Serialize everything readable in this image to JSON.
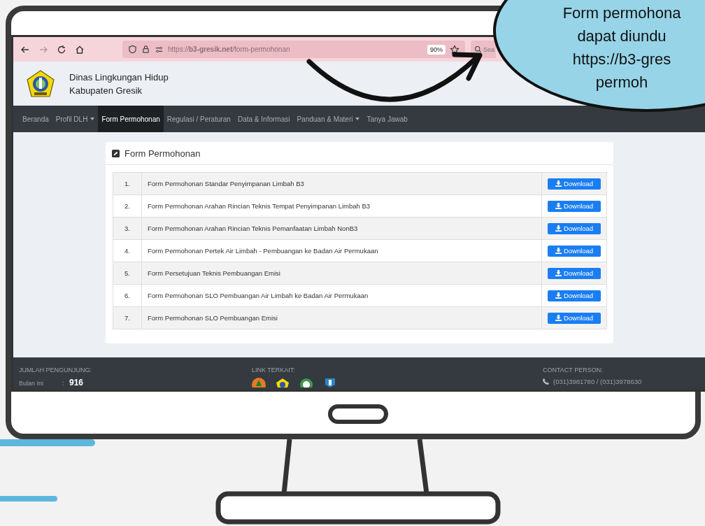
{
  "callout": {
    "lines": [
      "Form permohona",
      "dapat diundu",
      "https://b3-gres",
      "permoh"
    ]
  },
  "browser": {
    "forward_disabled": true,
    "url": "https://**b3-gresik.net**/form-permohonan",
    "zoom": "90%",
    "search": {
      "placeholder": "Sea"
    }
  },
  "site": {
    "name_lines": [
      "Dinas Lingkungan Hidup",
      "Kabupaten Gresik"
    ]
  },
  "nav": [
    {
      "label": "Beranda",
      "dropdown": false,
      "selected": false
    },
    {
      "label": "Profil DLH",
      "dropdown": true,
      "selected": false
    },
    {
      "label": "Form Permohonan",
      "dropdown": false,
      "selected": true
    },
    {
      "label": "Regulasi / Peraturan",
      "dropdown": false,
      "selected": false
    },
    {
      "label": "Data & Informasi",
      "dropdown": false,
      "selected": false
    },
    {
      "label": "Panduan & Materi",
      "dropdown": true,
      "selected": false
    },
    {
      "label": "Tanya Jawab",
      "dropdown": false,
      "selected": false
    }
  ],
  "panel": {
    "title": "Form Permohonan",
    "rows": [
      {
        "number": "1.",
        "title": "Form Permohonan Standar Penyimpanan Limbah B3",
        "button": "Download"
      },
      {
        "number": "2.",
        "title": "Form Permohonan Arahan Rincian Teknis Tempat Penyimpanan Limbah B3",
        "button": "Download"
      },
      {
        "number": "3.",
        "title": "Form Permohonan Arahan Rincian Teknis Pemanfaatan Limbah NonB3",
        "button": "Download"
      },
      {
        "number": "4.",
        "title": "Form Permohonan Pertek Air Limbah - Pembuangan ke Badan Air Permukaan",
        "button": "Download"
      },
      {
        "number": "5.",
        "title": "Form Persetujuan Teknis Pembuangan Emisi",
        "button": "Download"
      },
      {
        "number": "6.",
        "title": "Form Permohonan SLO Pembuangan Air Limbah ke Badan Air Permukaan",
        "button": "Download"
      },
      {
        "number": "7.",
        "title": "Form Permohonan SLO Pembuangan Emisi",
        "button": "Download"
      }
    ]
  },
  "footer": {
    "visitors": {
      "heading": "JUMLAH PENGUNJUNG:",
      "label": "Bulan Ini",
      "separator": ":",
      "value": "916"
    },
    "links": {
      "heading": "LINK TERKAIT:"
    },
    "contact": {
      "heading": "CONTACT PERSON:",
      "phone": "(031)3981780 / (031)3978630"
    }
  }
}
